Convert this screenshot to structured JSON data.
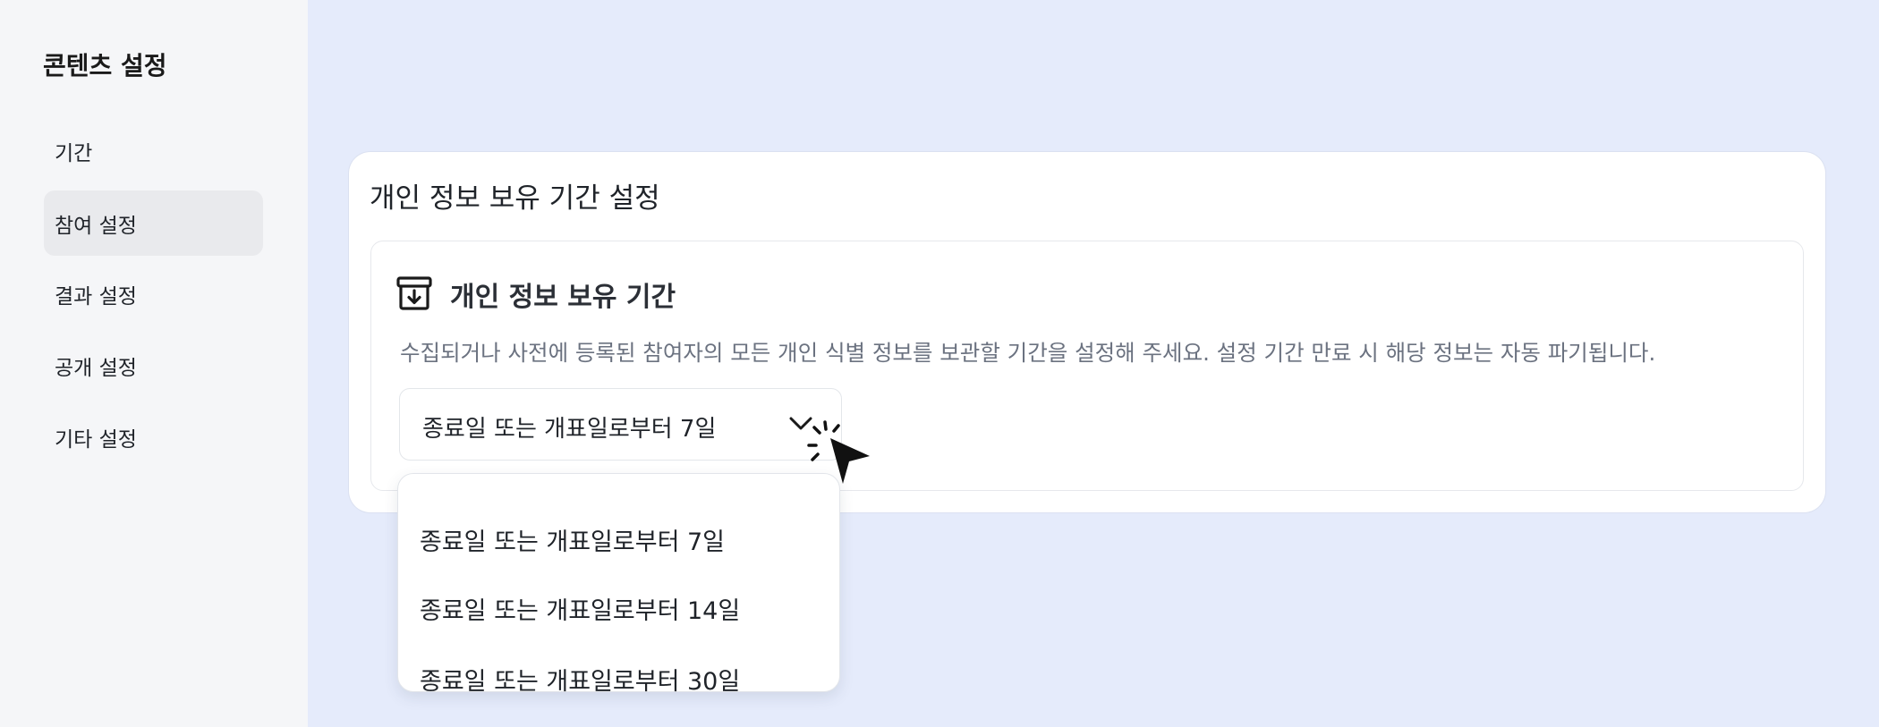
{
  "sidebar": {
    "title": "콘텐츠 설정",
    "items": [
      {
        "label": "기간"
      },
      {
        "label": "참여 설정"
      },
      {
        "label": "결과 설정"
      },
      {
        "label": "공개 설정"
      },
      {
        "label": "기타 설정"
      }
    ],
    "active_index": 1
  },
  "card": {
    "title": "개인 정보 보유 기간 설정",
    "section": {
      "icon": "archive-download-icon",
      "title": "개인 정보 보유 기간",
      "description": "수집되거나 사전에 등록된 참여자의 모든 개인 식별 정보를 보관할 기간을 설정해 주세요. 설정 기간 만료 시 해당 정보는 자동 파기됩니다.",
      "select": {
        "value": "종료일 또는 개표일로부터 7일",
        "icon": "chevron-down-icon",
        "options": [
          {
            "label": "종료일 또는 개표일로부터 7일"
          },
          {
            "label": "종료일 또는 개표일로부터 14일"
          },
          {
            "label": "종료일 또는 개표일로부터 30일"
          }
        ]
      }
    }
  },
  "colors": {
    "background": "#e5ebfb",
    "sidebar_bg": "#f5f6f8",
    "active_item_bg": "#e9eaed",
    "card_bg": "#ffffff"
  },
  "cursor": {
    "icon": "click-pointer-icon"
  }
}
